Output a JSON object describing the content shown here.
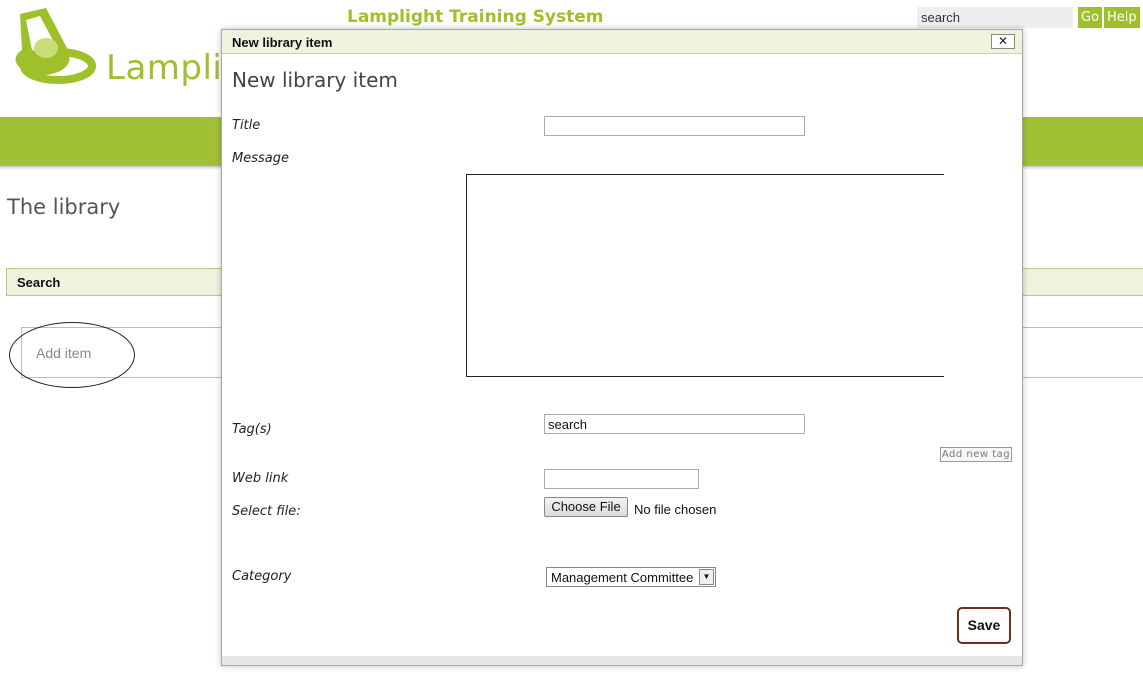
{
  "header": {
    "logo_text": "Lamplig",
    "site_title": "Lamplight Training System",
    "search_value": "search",
    "go_label": "Go",
    "help_label": "Help"
  },
  "page": {
    "heading": "The library",
    "search_bar_label": "Search",
    "add_item_label": "Add item"
  },
  "modal": {
    "bar_title": "New library item",
    "close_glyph": "✕",
    "heading": "New library item",
    "title_label": "Title",
    "title_value": "",
    "message_label": "Message",
    "message_value": "",
    "tags_label": "Tag(s)",
    "tags_value": "search",
    "add_tag_label": "Add new tag",
    "weblink_label": "Web link",
    "weblink_value": "",
    "file_label": "Select file:",
    "choose_file_label": "Choose File",
    "no_file_text": "No file chosen",
    "category_label": "Category",
    "category_value": "Management Committee",
    "save_label": "Save"
  },
  "colors": {
    "brand_green": "#9dc02b",
    "band_green": "#a1c035",
    "panel_bg": "#eef3de",
    "save_border": "#6b2f1e"
  },
  "icons": {
    "logo": "lamp-icon",
    "close": "close-icon",
    "dropdown": "chevron-down-icon"
  }
}
